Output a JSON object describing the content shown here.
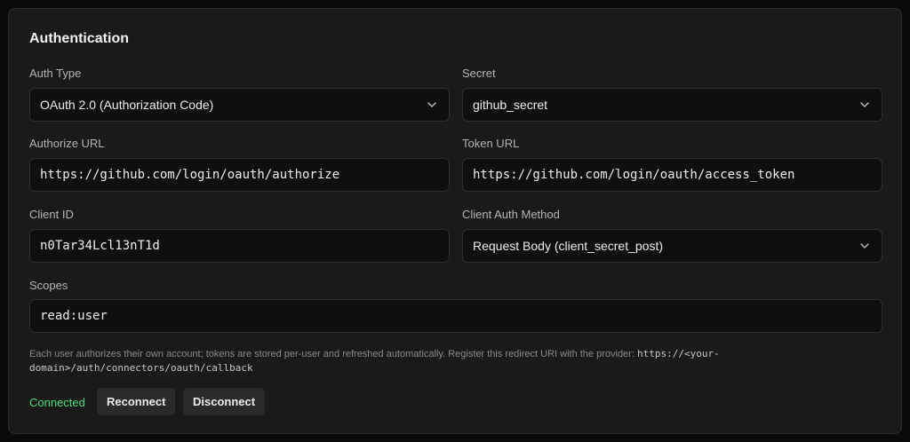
{
  "section": {
    "title": "Authentication"
  },
  "auth_type": {
    "label": "Auth Type",
    "value": "OAuth 2.0 (Authorization Code)",
    "icon": "chevron-down-icon"
  },
  "secret": {
    "label": "Secret",
    "value": "github_secret",
    "icon": "chevron-down-icon"
  },
  "authorize_url": {
    "label": "Authorize URL",
    "value": "https://github.com/login/oauth/authorize"
  },
  "token_url": {
    "label": "Token URL",
    "value": "https://github.com/login/oauth/access_token"
  },
  "client_id": {
    "label": "Client ID",
    "value": "n0Tar34Lcl13nT1d"
  },
  "client_auth_method": {
    "label": "Client Auth Method",
    "value": "Request Body (client_secret_post)",
    "icon": "chevron-down-icon"
  },
  "scopes": {
    "label": "Scopes",
    "value": "read:user"
  },
  "hint": {
    "text": "Each user authorizes their own account; tokens are stored per-user and refreshed automatically. Register this redirect URI with the provider: ",
    "redirect_uri": "https://<your-domain>/auth/connectors/oauth/callback"
  },
  "status": {
    "text": "Connected",
    "color": "#4ade80"
  },
  "actions": {
    "reconnect": "Reconnect",
    "disconnect": "Disconnect"
  }
}
